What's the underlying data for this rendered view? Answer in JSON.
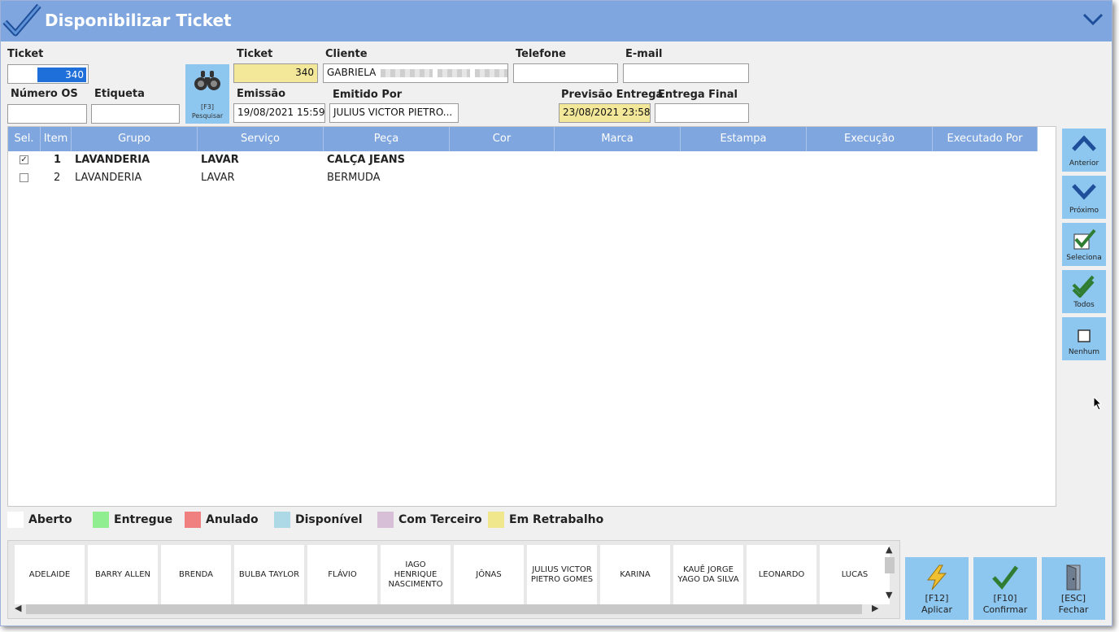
{
  "window": {
    "title": "Disponibilizar Ticket"
  },
  "search": {
    "ticket_label": "Ticket",
    "ticket_value": "340",
    "os_label": "Número OS",
    "os_value": "",
    "tag_label": "Etiqueta",
    "tag_value": "",
    "search_button": "[F3]\nPesquisar"
  },
  "details": {
    "ticket_label": "Ticket",
    "ticket_value": "340",
    "client_label": "Cliente",
    "client_value": "GABRIELA",
    "phone_label": "Telefone",
    "phone_value": "",
    "email_label": "E-mail",
    "email_value": "",
    "emission_label": "Emissão",
    "emission_value": "19/08/2021 15:59",
    "issued_by_label": "Emitido Por",
    "issued_by_value": "JULIUS  VICTOR  PIETRO...",
    "forecast_label": "Previsão Entrega",
    "forecast_value": "23/08/2021 23:58",
    "final_label": "Entrega Final",
    "final_value": ""
  },
  "grid": {
    "columns": [
      "Sel.",
      "Item",
      "Grupo",
      "Serviço",
      "Peça",
      "Cor",
      "Marca",
      "Estampa",
      "Execução",
      "Executado Por"
    ],
    "rows": [
      {
        "selected": true,
        "item": "1",
        "grupo": "LAVANDERIA",
        "servico": "LAVAR",
        "peca": "CALÇA JEANS"
      },
      {
        "selected": false,
        "item": "2",
        "grupo": "LAVANDERIA",
        "servico": "LAVAR",
        "peca": "BERMUDA"
      }
    ]
  },
  "side_buttons": {
    "previous": "Anterior",
    "next": "Próximo",
    "select": "Seleciona",
    "all": "Todos",
    "none": "Nenhum"
  },
  "legend": [
    {
      "label": "Aberto",
      "color": "#ffffff"
    },
    {
      "label": "Entregue",
      "color": "#90ee90"
    },
    {
      "label": "Anulado",
      "color": "#f08080"
    },
    {
      "label": "Disponível",
      "color": "#add8e6"
    },
    {
      "label": "Com Terceiro",
      "color": "#d8bfd8"
    },
    {
      "label": "Em Retrabalho",
      "color": "#f0e68c"
    }
  ],
  "technicians": [
    "ADELAIDE",
    "BARRY ALLEN",
    "BRENDA",
    "BULBA TAYLOR",
    "FLÁVIO",
    "IAGO HENRIQUE NASCIMENTO",
    "JÔNAS",
    "JULIUS VICTOR PIETRO GOMES",
    "KARINA",
    "KAUÊ JORGE YAGO DA SILVA",
    "LEONARDO",
    "LUCAS"
  ],
  "actions": {
    "apply_key": "[F12]",
    "apply_label": "Aplicar",
    "confirm_key": "[F10]",
    "confirm_label": "Confirmar",
    "close_key": "[ESC]",
    "close_label": "Fechar"
  },
  "colors": {
    "accent": "#7fa6de",
    "button": "#8dc6ee",
    "highlight_field": "#f3e79a"
  }
}
